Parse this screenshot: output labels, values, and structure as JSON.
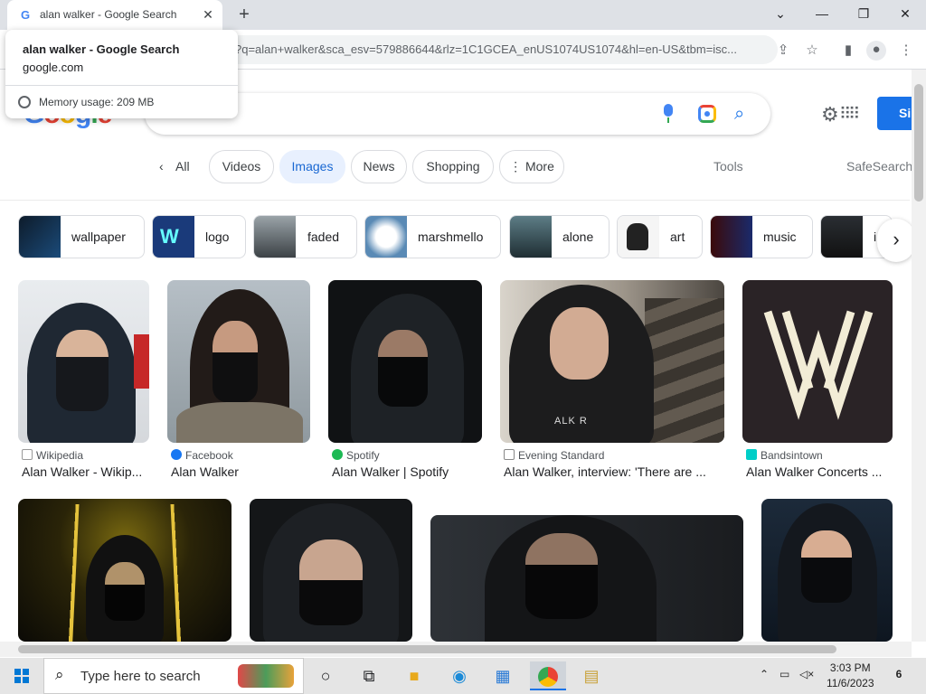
{
  "browser": {
    "tab_title": "alan walker - Google Search",
    "tab_favicon": "G",
    "new_tab": "+",
    "url": "?q=alan+walker&sca_esv=579886644&rlz=1C1GCEA_enUS1074US1074&hl=en-US&tbm=isc...",
    "hovercard": {
      "title": "alan walker - Google Search",
      "domain": "google.com",
      "memory": "Memory usage: 209 MB"
    }
  },
  "google": {
    "sign_in_label": "Si"
  },
  "filters": {
    "all": "All",
    "videos": "Videos",
    "images": "Images",
    "news": "News",
    "shopping": "Shopping",
    "more": "More",
    "tools": "Tools",
    "safesearch": "SafeSearch"
  },
  "related": [
    {
      "label": "wallpaper"
    },
    {
      "label": "logo"
    },
    {
      "label": "faded"
    },
    {
      "label": "marshmello"
    },
    {
      "label": "alone"
    },
    {
      "label": "art"
    },
    {
      "label": "music"
    },
    {
      "label": "i"
    }
  ],
  "results": [
    {
      "source": "Wikipedia",
      "caption": "Alan Walker - Wikip...",
      "source_color": "#202124"
    },
    {
      "source": "Facebook",
      "caption": "Alan Walker",
      "source_color": "#1877f2"
    },
    {
      "source": "Spotify",
      "caption": "Alan Walker | Spotify",
      "source_color": "#1db954"
    },
    {
      "source": "Evening Standard",
      "caption": "Alan Walker, interview: 'There are ...",
      "source_color": "#333333"
    },
    {
      "source": "Bandsintown",
      "caption": "Alan Walker Concerts ...",
      "source_color": "#00cec8"
    }
  ],
  "result_tile_text": {
    "hoodie_text": "ALK R"
  },
  "taskbar": {
    "search_placeholder": "Type here to search",
    "time": "3:03 PM",
    "date": "11/6/2023",
    "notifications": "6"
  }
}
